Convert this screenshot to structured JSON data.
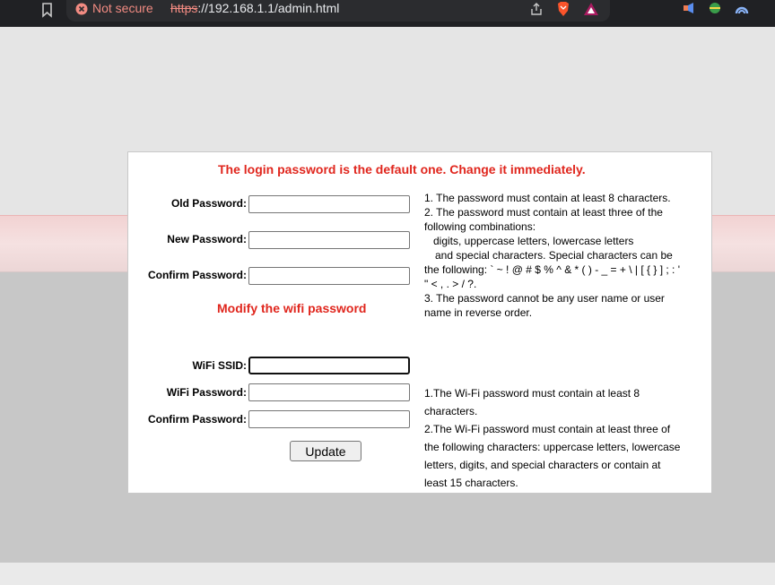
{
  "browser": {
    "not_secure": "Not secure",
    "url_scheme": "https",
    "url_rest": "://192.168.1.1/admin.html"
  },
  "login": {
    "heading": "The login password is the default one. Change it immediately.",
    "old_password_label": "Old Password:",
    "new_password_label": "New Password:",
    "confirm_password_label": "Confirm Password:",
    "old_password_value": "",
    "new_password_value": "",
    "confirm_password_value": "",
    "rules": [
      "1. The password must contain at least 8 characters.",
      "2. The password must contain at least three of the following combinations:",
      "digits, uppercase letters, lowercase letters",
      "and special characters. Special characters can be the following: ` ~ ! @ # $ % ^ & * ( ) - _ = + \\ | [ { } ] ; : ' \" < , . > / ?.",
      "3. The password cannot be any user name or user name in reverse order."
    ]
  },
  "wifi": {
    "heading": "Modify the wifi password",
    "ssid_label": "WiFi SSID:",
    "password_label": "WiFi Password:",
    "confirm_password_label": "Confirm Password:",
    "ssid_value": "",
    "password_value": "",
    "confirm_password_value": "",
    "rules": [
      "1.The Wi-Fi password must contain at least 8 characters.",
      "2.The Wi-Fi password must contain at least three of the following characters: uppercase letters, lowercase letters, digits, and special characters or contain at least 15 characters."
    ]
  },
  "update_label": "Update",
  "colors": {
    "heading_red": "#e0261d",
    "chrome_bg": "#202124",
    "not_secure_red": "#f28b82"
  }
}
